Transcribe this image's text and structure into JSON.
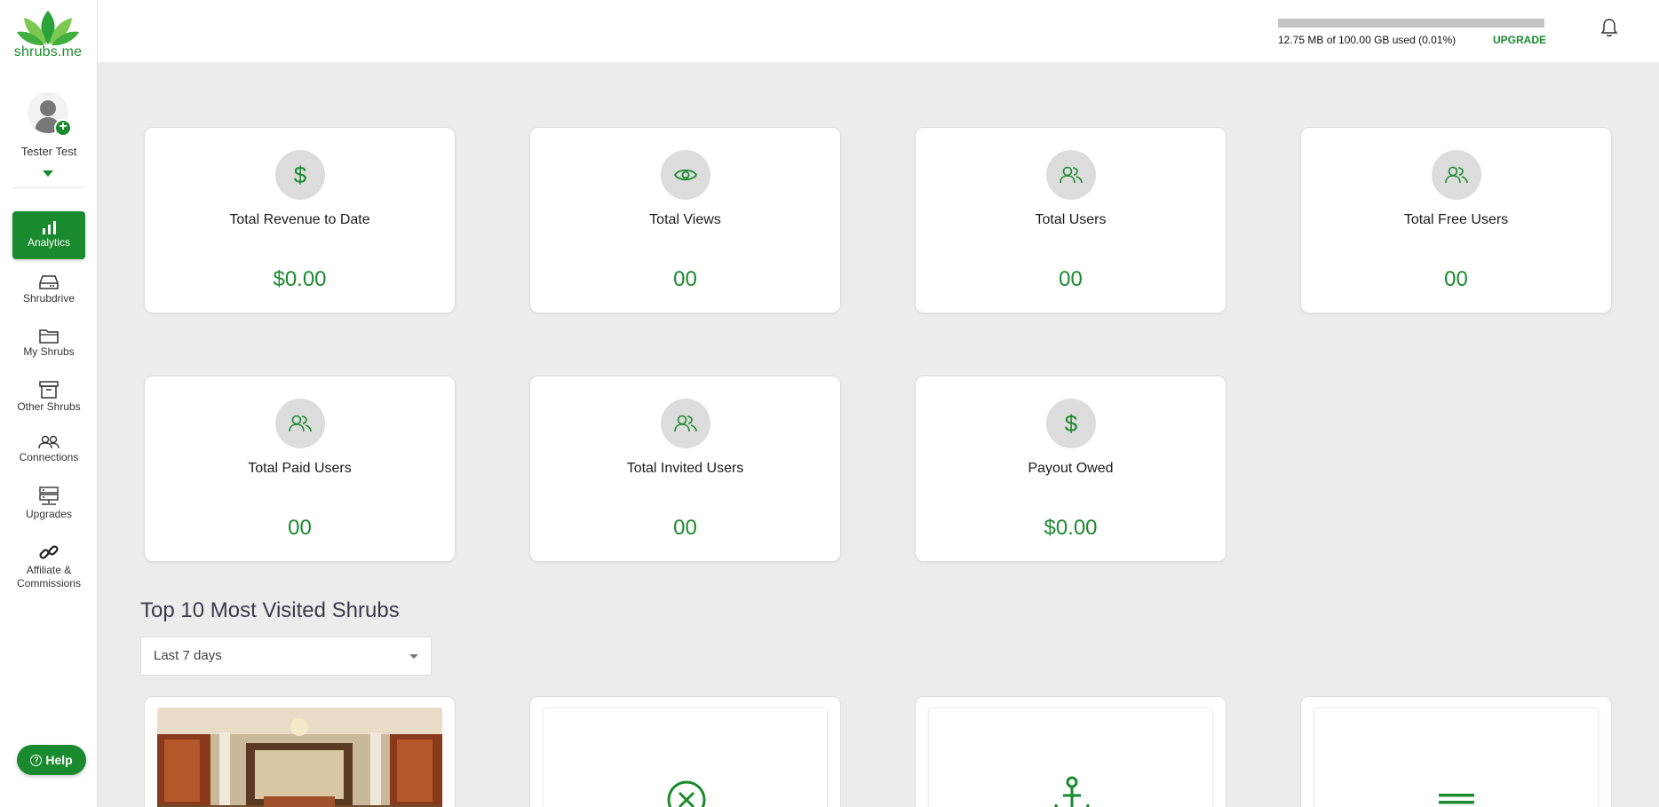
{
  "brand": {
    "name": "shrubs.me",
    "accent": "#1a8a2e"
  },
  "user": {
    "name": "Tester Test"
  },
  "sidebar": {
    "items": [
      {
        "label": "Analytics",
        "icon": "bar-chart-icon",
        "active": true
      },
      {
        "label": "Shrubdrive",
        "icon": "hard-drive-icon"
      },
      {
        "label": "My Shrubs",
        "icon": "folder-icon"
      },
      {
        "label": "Other Shrubs",
        "icon": "archive-box-icon"
      },
      {
        "label": "Connections",
        "icon": "users-icon"
      },
      {
        "label": "Upgrades",
        "icon": "server-icon"
      },
      {
        "label": "Affiliate &",
        "label2": "Commissions",
        "icon": "link-icon"
      }
    ],
    "help_label": "Help"
  },
  "topbar": {
    "storage_text": "12.75 MB of 100.00 GB used (0.01%)",
    "storage_fraction": 0.0001,
    "upgrade_label": "UPGRADE"
  },
  "stats": [
    {
      "title": "Total Revenue to Date",
      "value": "$0.00",
      "icon": "dollar-icon"
    },
    {
      "title": "Total Views",
      "value": "00",
      "icon": "eye-icon"
    },
    {
      "title": "Total Users",
      "value": "00",
      "icon": "users-icon"
    },
    {
      "title": "Total Free Users",
      "value": "00",
      "icon": "users-icon"
    },
    {
      "title": "Total Paid Users",
      "value": "00",
      "icon": "users-icon"
    },
    {
      "title": "Total Invited Users",
      "value": "00",
      "icon": "users-icon"
    },
    {
      "title": "Payout Owed",
      "value": "$0.00",
      "icon": "dollar-icon"
    }
  ],
  "top_shrubs": {
    "title": "Top 10 Most Visited Shrubs",
    "filter": {
      "selected": "Last 7 days"
    },
    "cards": [
      {
        "type": "image",
        "icon": "hotel-lobby-image"
      },
      {
        "type": "icon",
        "icon": "x-circle-icon"
      },
      {
        "type": "icon",
        "icon": "anchor-icon"
      },
      {
        "type": "icon",
        "icon": "menu-lines-icon"
      }
    ]
  }
}
